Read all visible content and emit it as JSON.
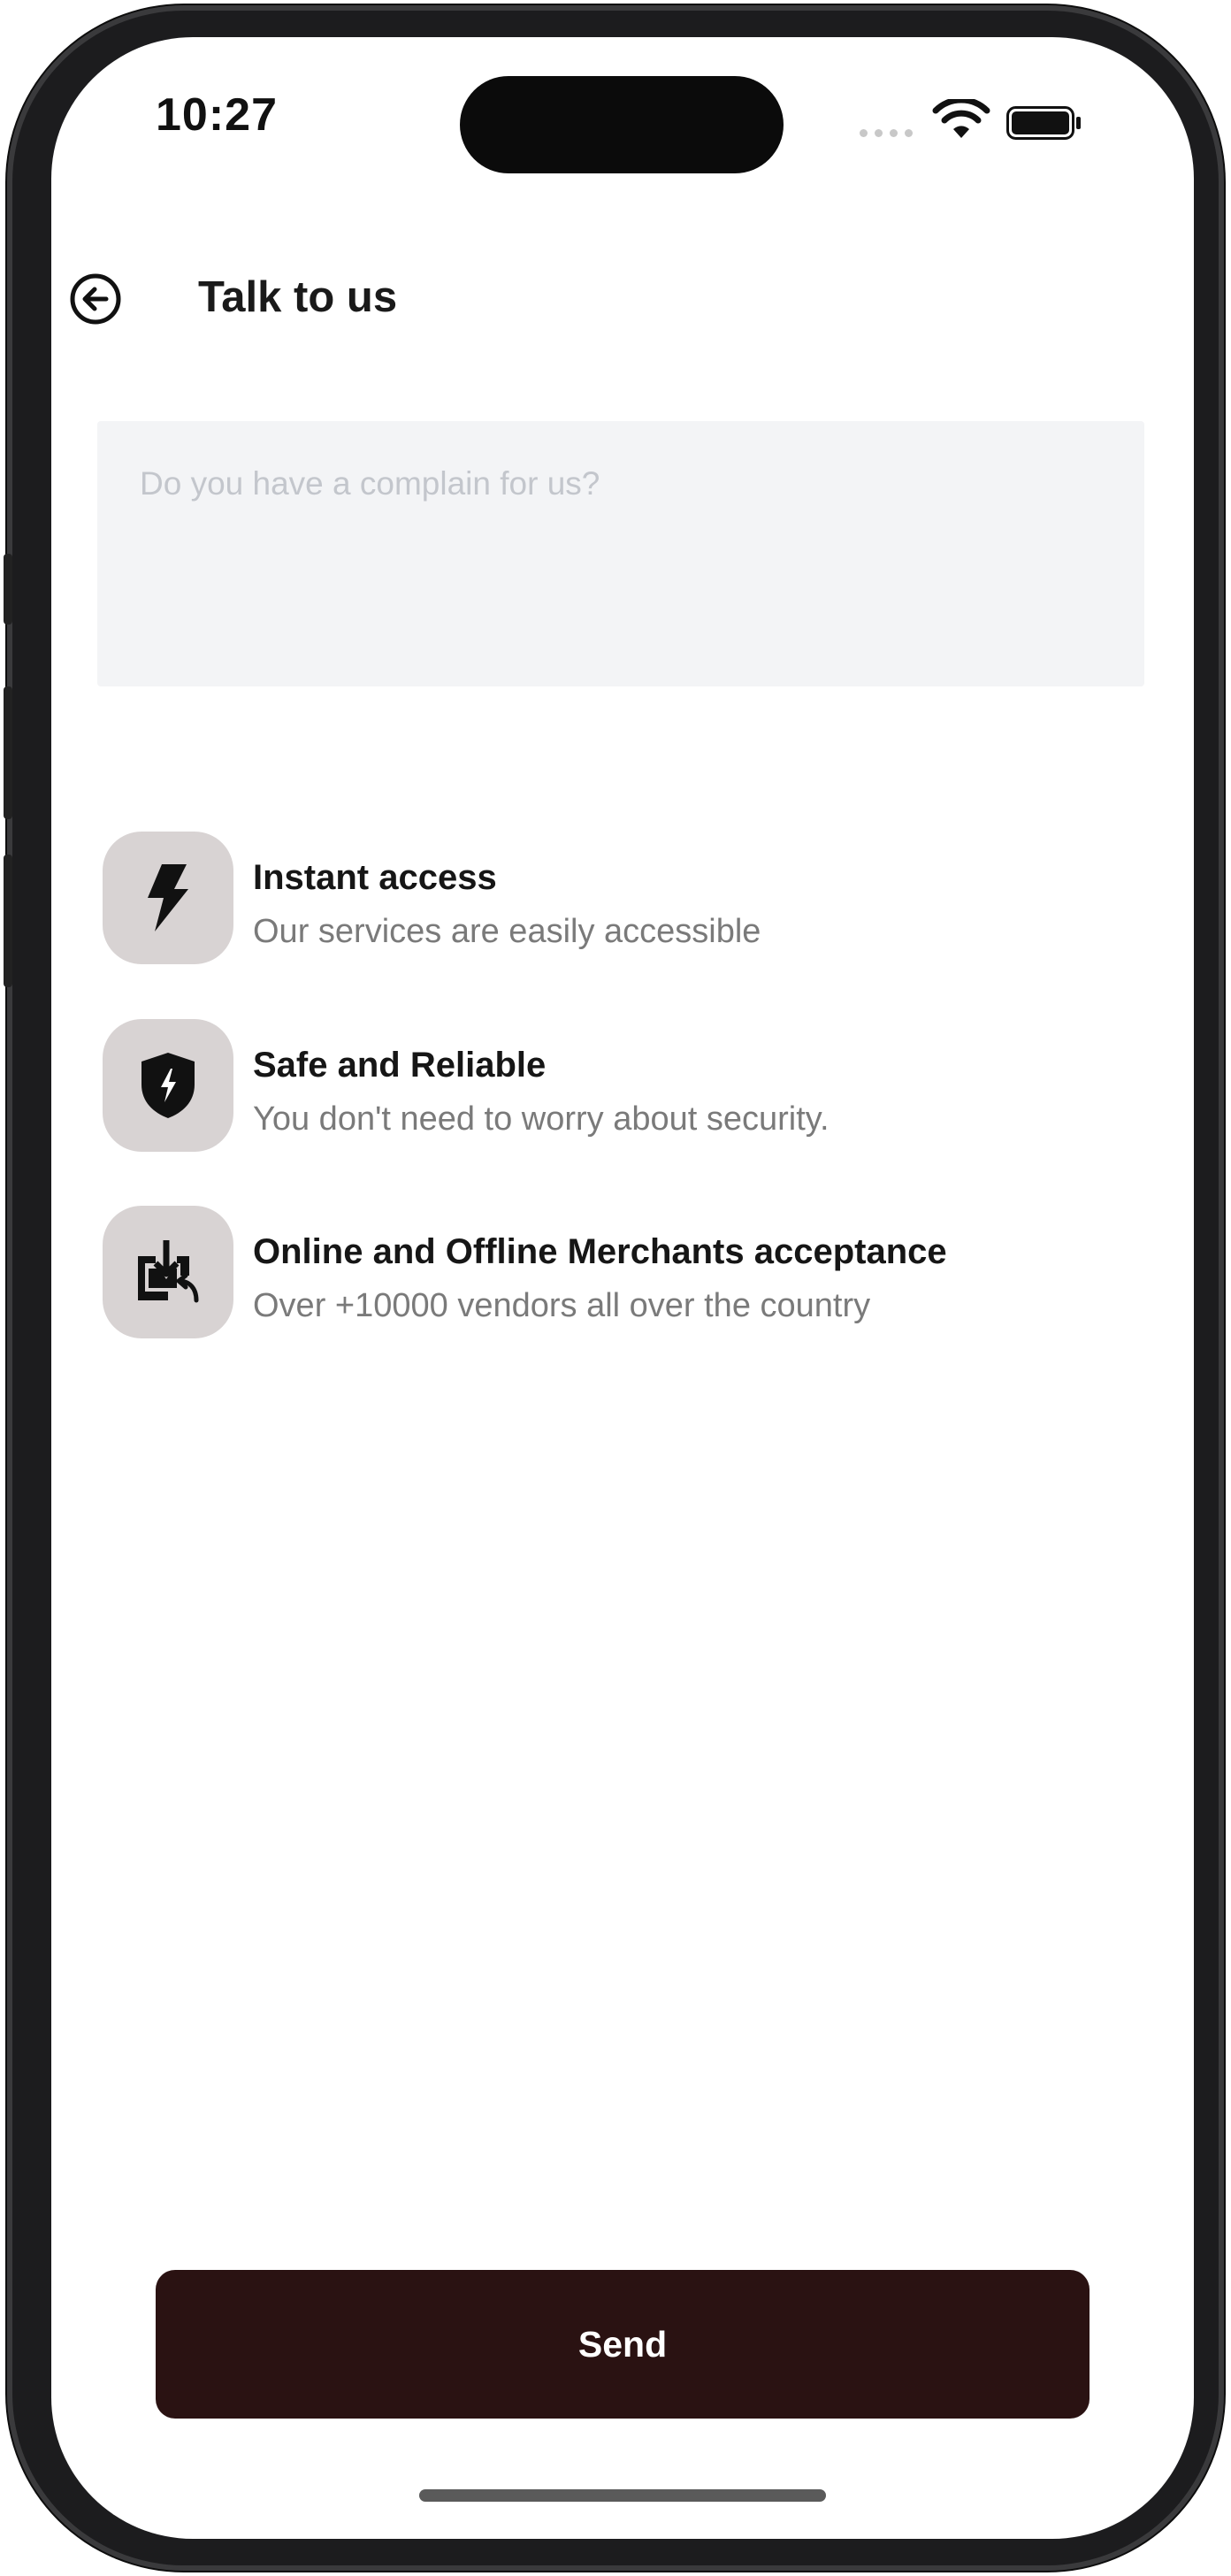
{
  "status_bar": {
    "time": "10:27",
    "wifi_icon": "wifi-icon",
    "battery_icon": "battery-icon"
  },
  "header": {
    "back_icon": "arrow-left-circle-icon",
    "title": "Talk to us"
  },
  "complaint": {
    "value": "",
    "placeholder": "Do you have a complain for us?"
  },
  "features": [
    {
      "icon": "lightning-icon",
      "title": "Instant access",
      "description": "Our services are easily accessible"
    },
    {
      "icon": "shield-lightning-icon",
      "title": "Safe and Reliable",
      "description": "You don't need to worry about security."
    },
    {
      "icon": "store-download-icon",
      "title": "Online and Offline Merchants acceptance",
      "description": "Over +10000 vendors all over the country"
    }
  ],
  "send_button": {
    "label": "Send"
  },
  "colors": {
    "primary_button": "#2a1212",
    "icon_tile": "#d8d3d3",
    "input_background": "#f3f4f6"
  }
}
